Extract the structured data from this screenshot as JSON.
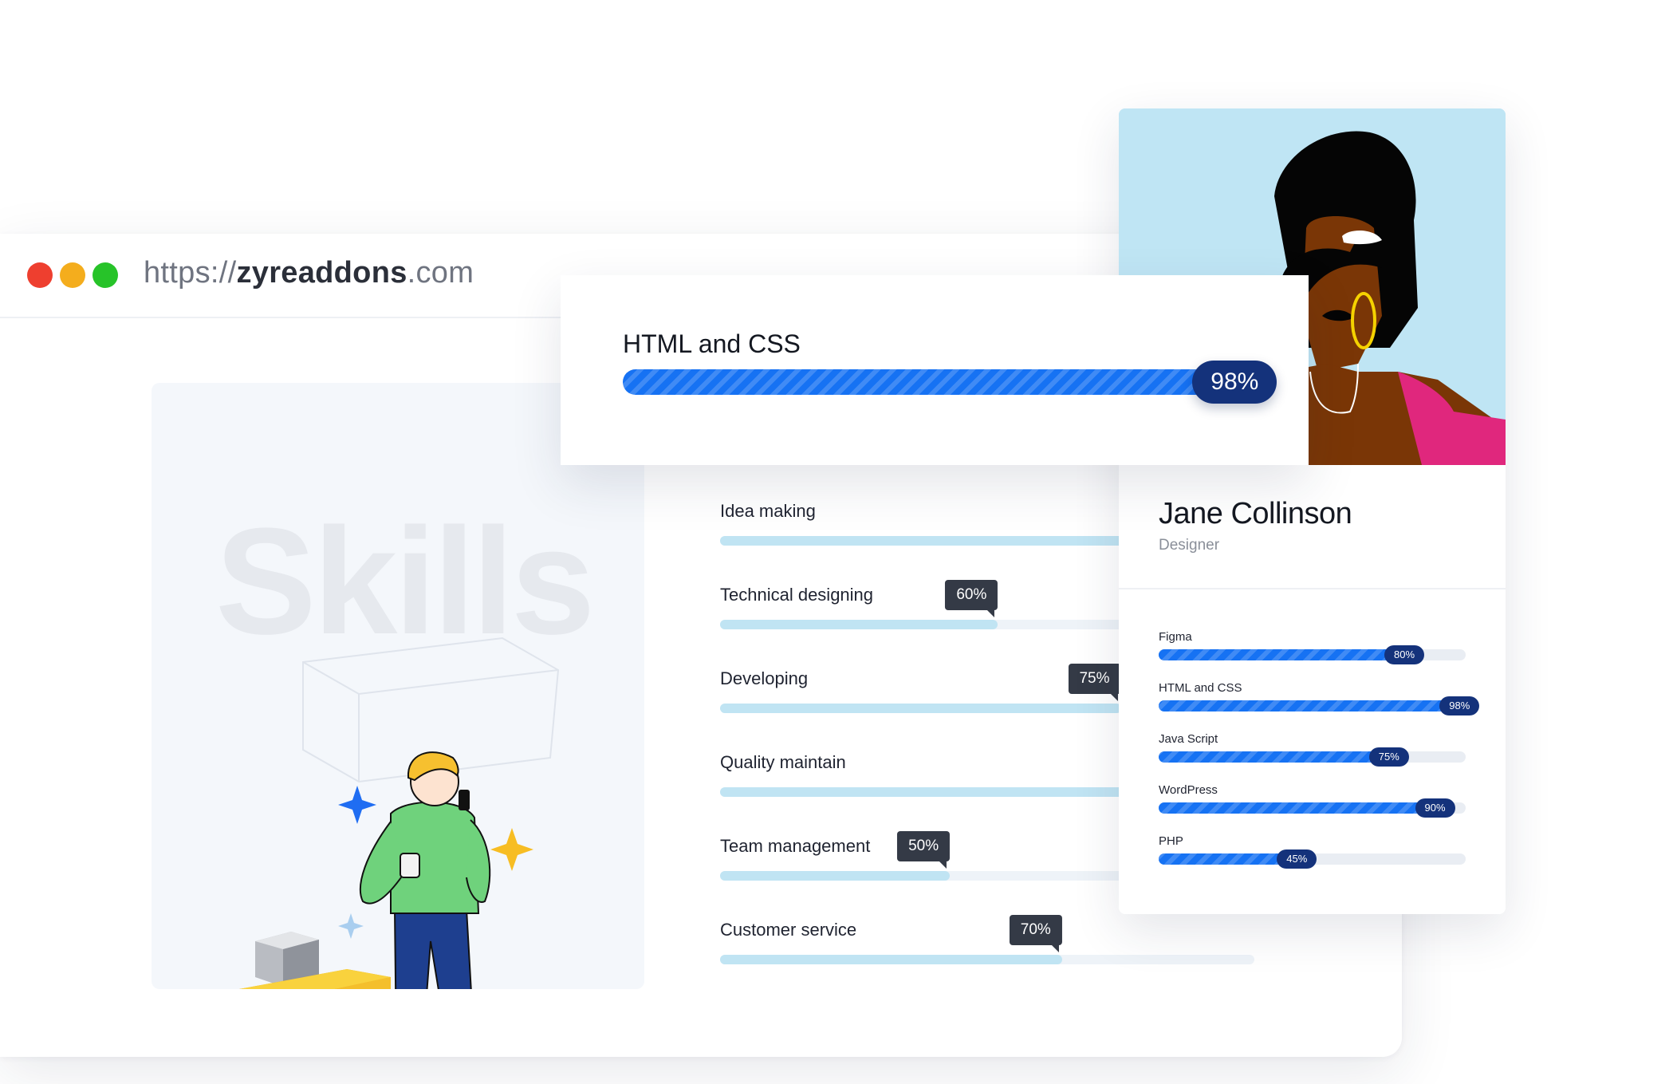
{
  "browser": {
    "url_scheme": "https://",
    "url_domain": "zyreaddons",
    "url_tld": ".com"
  },
  "skills_panel": {
    "watermark": "Skills"
  },
  "skills": [
    {
      "label": "Idea making",
      "value": 80,
      "tooltip": ""
    },
    {
      "label": "Technical designing",
      "value": 52,
      "tooltip": "60%"
    },
    {
      "label": "Developing",
      "value": 75,
      "tooltip": "75%"
    },
    {
      "label": "Quality maintain",
      "value": 80,
      "tooltip": ""
    },
    {
      "label": "Team management",
      "value": 43,
      "tooltip": "50%"
    },
    {
      "label": "Customer service",
      "value": 64,
      "tooltip": "70%"
    }
  ],
  "featured_skill": {
    "label": "HTML and CSS",
    "value": 98,
    "badge": "98%"
  },
  "profile": {
    "name": "Jane Collinson",
    "role": "Designer",
    "skills": [
      {
        "label": "Figma",
        "value": 80,
        "badge": "80%"
      },
      {
        "label": "HTML and CSS",
        "value": 98,
        "badge": "98%"
      },
      {
        "label": "Java Script",
        "value": 75,
        "badge": "75%"
      },
      {
        "label": "WordPress",
        "value": 90,
        "badge": "90%"
      },
      {
        "label": "PHP",
        "value": 45,
        "badge": "45%"
      }
    ]
  },
  "colors": {
    "accent": "#1672f3",
    "badge": "#14327b",
    "light_bar": "#c0e4f3",
    "tooltip": "#343a46"
  }
}
